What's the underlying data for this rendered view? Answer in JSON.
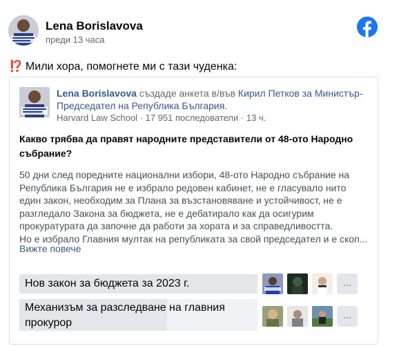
{
  "author": {
    "name": "Lena Borislavova",
    "time": "преди 13 часа"
  },
  "post": {
    "emoji": "⁉️",
    "text": "Мили хора, помогнете ми с тази чуденка:"
  },
  "shared": {
    "author": "Lena Borislavova",
    "action": " създаде анкета в/във ",
    "group": "Кирил Петков за Министър-Председател на Република България.",
    "source": "Harvard Law School",
    "followers": "17 951 последователи",
    "time": "13 ч.",
    "question": "Какво трябва да правят народните представители от 48-ото Народно събрание?",
    "description": "50 дни след поредните национални избори, 48-ото Народно събрание на Република България не е избрало редовен кабинет, не е гласувало нито един закон, необходим за Плана за възстановяване и устойчивост, не е разгледало Закона за бюджета, не е дебатирало как да осигурим прокуратурата да започне да работи за хората и за справедливостта.",
    "description2": "Но е избрало Главния мултак на републиката за свой председател и е скоп...",
    "see_more": "Вижте повече"
  },
  "poll": {
    "options": [
      {
        "label": "Нов закон за бюджета за 2023 г.",
        "fill": 1.0
      },
      {
        "label": "Механизъм за разследване на главния прокурор",
        "fill": 0.62
      }
    ],
    "more_label": "..."
  },
  "colors": {
    "fb_blue": "#1877f2",
    "link": "#385898",
    "muted": "#65676b"
  }
}
